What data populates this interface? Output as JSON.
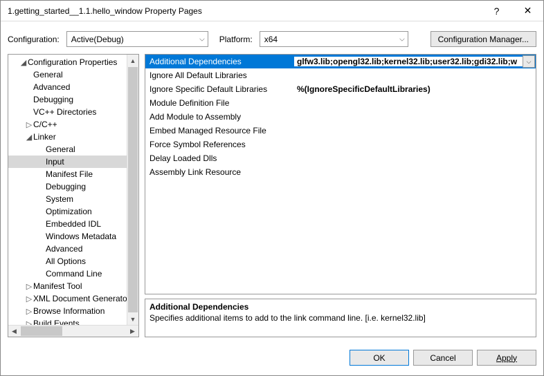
{
  "titlebar": {
    "title": "1.getting_started__1.1.hello_window Property Pages",
    "help": "?",
    "close": "✕"
  },
  "configRow": {
    "configLabel": "Configuration:",
    "configValue": "Active(Debug)",
    "platformLabel": "Platform:",
    "platformValue": "x64",
    "managerBtn": "Configuration Manager..."
  },
  "tree": {
    "root": "Configuration Properties",
    "items": [
      {
        "label": "General",
        "indent": 1
      },
      {
        "label": "Advanced",
        "indent": 1
      },
      {
        "label": "Debugging",
        "indent": 1
      },
      {
        "label": "VC++ Directories",
        "indent": 1
      },
      {
        "label": "C/C++",
        "indent": 1,
        "exp": "▷"
      },
      {
        "label": "Linker",
        "indent": 1,
        "exp": "◢"
      },
      {
        "label": "General",
        "indent": 2
      },
      {
        "label": "Input",
        "indent": 2,
        "selected": true
      },
      {
        "label": "Manifest File",
        "indent": 2
      },
      {
        "label": "Debugging",
        "indent": 2
      },
      {
        "label": "System",
        "indent": 2
      },
      {
        "label": "Optimization",
        "indent": 2
      },
      {
        "label": "Embedded IDL",
        "indent": 2
      },
      {
        "label": "Windows Metadata",
        "indent": 2
      },
      {
        "label": "Advanced",
        "indent": 2
      },
      {
        "label": "All Options",
        "indent": 2
      },
      {
        "label": "Command Line",
        "indent": 2
      },
      {
        "label": "Manifest Tool",
        "indent": 1,
        "exp": "▷"
      },
      {
        "label": "XML Document Generator",
        "indent": 1,
        "exp": "▷"
      },
      {
        "label": "Browse Information",
        "indent": 1,
        "exp": "▷"
      },
      {
        "label": "Build Events",
        "indent": 1,
        "exp": "▷"
      }
    ]
  },
  "grid": {
    "rows": [
      {
        "label": "Additional Dependencies",
        "value": "glfw3.lib;opengl32.lib;kernel32.lib;user32.lib;gdi32.lib;w",
        "selected": true,
        "dd": true
      },
      {
        "label": "Ignore All Default Libraries",
        "value": ""
      },
      {
        "label": "Ignore Specific Default Libraries",
        "value": "%(IgnoreSpecificDefaultLibraries)"
      },
      {
        "label": "Module Definition File",
        "value": ""
      },
      {
        "label": "Add Module to Assembly",
        "value": ""
      },
      {
        "label": "Embed Managed Resource File",
        "value": ""
      },
      {
        "label": "Force Symbol References",
        "value": ""
      },
      {
        "label": "Delay Loaded Dlls",
        "value": ""
      },
      {
        "label": "Assembly Link Resource",
        "value": ""
      }
    ]
  },
  "description": {
    "title": "Additional Dependencies",
    "text": "Specifies additional items to add to the link command line. [i.e. kernel32.lib]"
  },
  "footer": {
    "ok": "OK",
    "cancel": "Cancel",
    "apply": "Apply"
  }
}
